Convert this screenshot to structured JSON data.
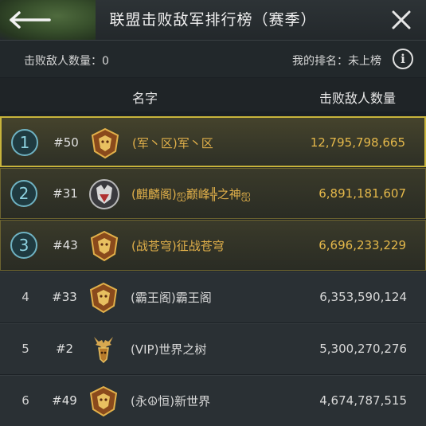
{
  "header": {
    "title": "联盟击败敌军排行榜（赛季）"
  },
  "info": {
    "defeated_label": "击败敌人数量：0",
    "my_rank_label": "我的排名：未上榜",
    "info_icon_glyph": "i"
  },
  "columns": {
    "name": "名字",
    "count": "击败敌人数量"
  },
  "rows": [
    {
      "rank": "1",
      "id": "#50",
      "name": "(军丶区)军丶区",
      "count": "12,795,798,665",
      "emblem": "gold-beast-emblem-icon"
    },
    {
      "rank": "2",
      "id": "#31",
      "name": "(麒麟阁)ஐ巅峰╬之神ஐ",
      "count": "6,891,181,607",
      "emblem": "silver-wolf-emblem-icon"
    },
    {
      "rank": "3",
      "id": "#43",
      "name": "(战苍穹)征战苍穹",
      "count": "6,696,233,229",
      "emblem": "gold-beast-emblem-icon"
    },
    {
      "rank": "4",
      "id": "#33",
      "name": "(霸王阁)霸王阁",
      "count": "6,353,590,124",
      "emblem": "gold-beast-emblem-icon"
    },
    {
      "rank": "5",
      "id": "#2",
      "name": "(VIP)世界之树",
      "count": "5,300,270,276",
      "emblem": "stag-emblem-icon"
    },
    {
      "rank": "6",
      "id": "#49",
      "name": "(永☮恒)新世界",
      "count": "4,674,787,515",
      "emblem": "gold-beast-emblem-icon"
    }
  ],
  "colors": {
    "gold_text": "#e4b84a",
    "rank_circle": "#6fb2c2",
    "highlight_border": "#c8b43c"
  }
}
